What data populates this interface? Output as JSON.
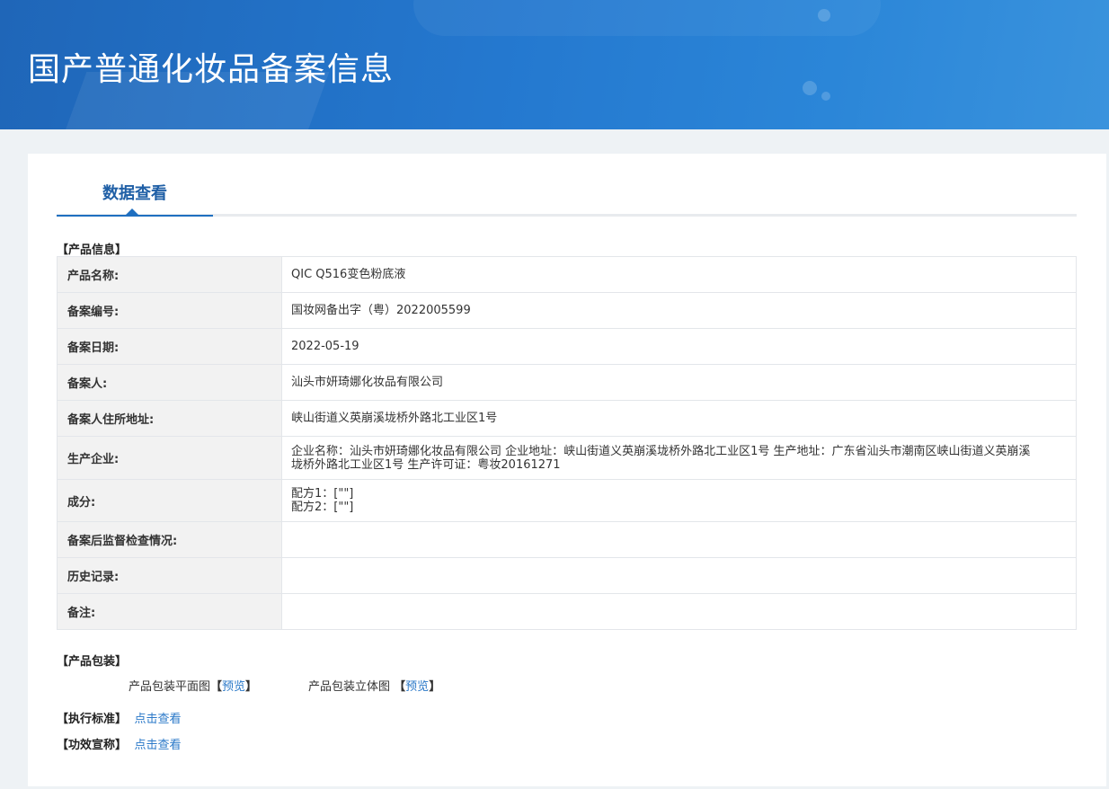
{
  "page": {
    "title": "国产普通化妆品备案信息"
  },
  "tab": {
    "label": "数据查看"
  },
  "product_info": {
    "heading": "【产品信息】",
    "rows": [
      {
        "label": "产品名称:",
        "value": "QIC Q516变色粉底液"
      },
      {
        "label": "备案编号:",
        "value": "国妆网备出字（粤）2022005599"
      },
      {
        "label": "备案日期:",
        "value": "2022-05-19"
      },
      {
        "label": "备案人:",
        "value": "汕头市妍琦娜化妆品有限公司"
      },
      {
        "label": "备案人住所地址:",
        "value": "峡山街道义英崩溪垅桥外路北工业区1号"
      },
      {
        "label": "生产企业:",
        "value": "企业名称：汕头市妍琦娜化妆品有限公司 企业地址：峡山街道义英崩溪垅桥外路北工业区1号 生产地址：广东省汕头市潮南区峡山街道义英崩溪垅桥外路北工业区1号 生产许可证：粤妆20161271"
      },
      {
        "label": "成分:",
        "value_lines": [
          "配方1：[\"\"]",
          "配方2：[\"\"]"
        ]
      },
      {
        "label": "备案后监督检查情况:",
        "value": ""
      },
      {
        "label": "历史记录:",
        "value": ""
      },
      {
        "label": "备注:",
        "value": ""
      }
    ]
  },
  "packaging": {
    "heading": "【产品包装】",
    "flat_label": "产品包装平面图",
    "flat_open": "【",
    "flat_link": "预览",
    "flat_close": "】",
    "solid_label": "产品包装立体图",
    "solid_open": "【",
    "solid_link": "预览",
    "solid_close": "】"
  },
  "standard": {
    "heading": "【执行标准】",
    "link": "点击查看"
  },
  "efficacy": {
    "heading": "【功效宣称】",
    "link": "点击查看"
  },
  "colors": {
    "banner": "#2478cf",
    "accent": "#1f5fa6",
    "link": "#2a78c8"
  }
}
